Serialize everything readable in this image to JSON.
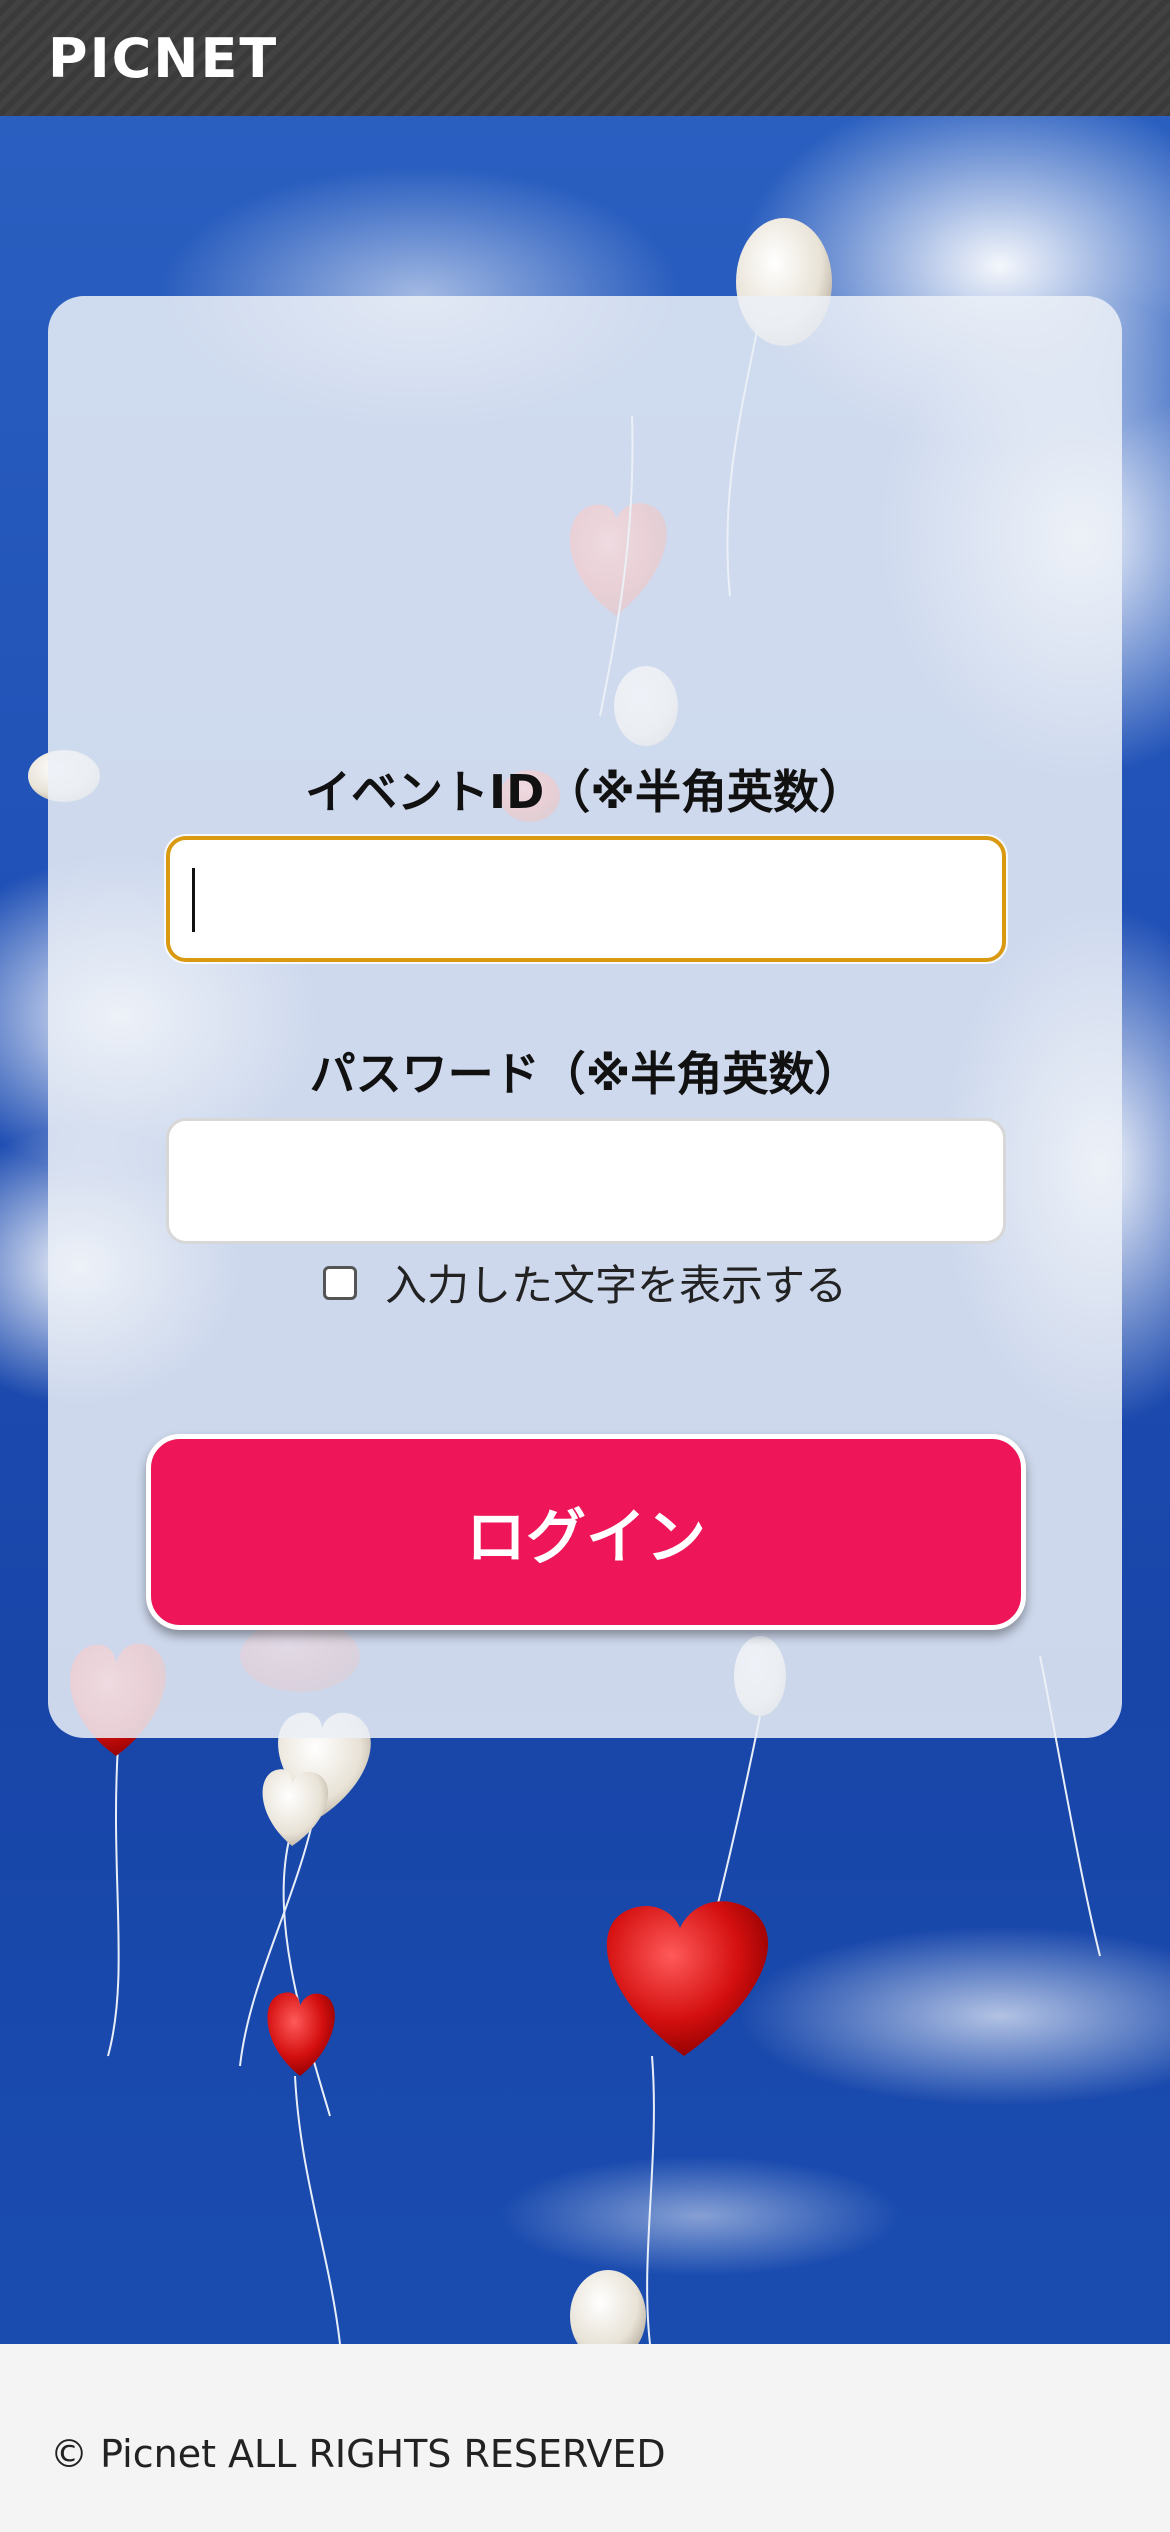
{
  "header": {
    "brand": "PICNET"
  },
  "form": {
    "event_id_label": "イベントID（※半角英数）",
    "event_id_value": "",
    "password_label": "パスワード（※半角英数）",
    "password_value": "",
    "show_password_label": "入力した文字を表示する",
    "show_password_checked": false,
    "login_button_label": "ログイン"
  },
  "footer": {
    "copyright": "© Picnet ALL RIGHTS RESERVED"
  },
  "colors": {
    "header_bg": "#3a3a3a",
    "accent_button": "#ee1558",
    "focus_border": "#d99a12",
    "footer_bg": "#f4f4f4"
  }
}
